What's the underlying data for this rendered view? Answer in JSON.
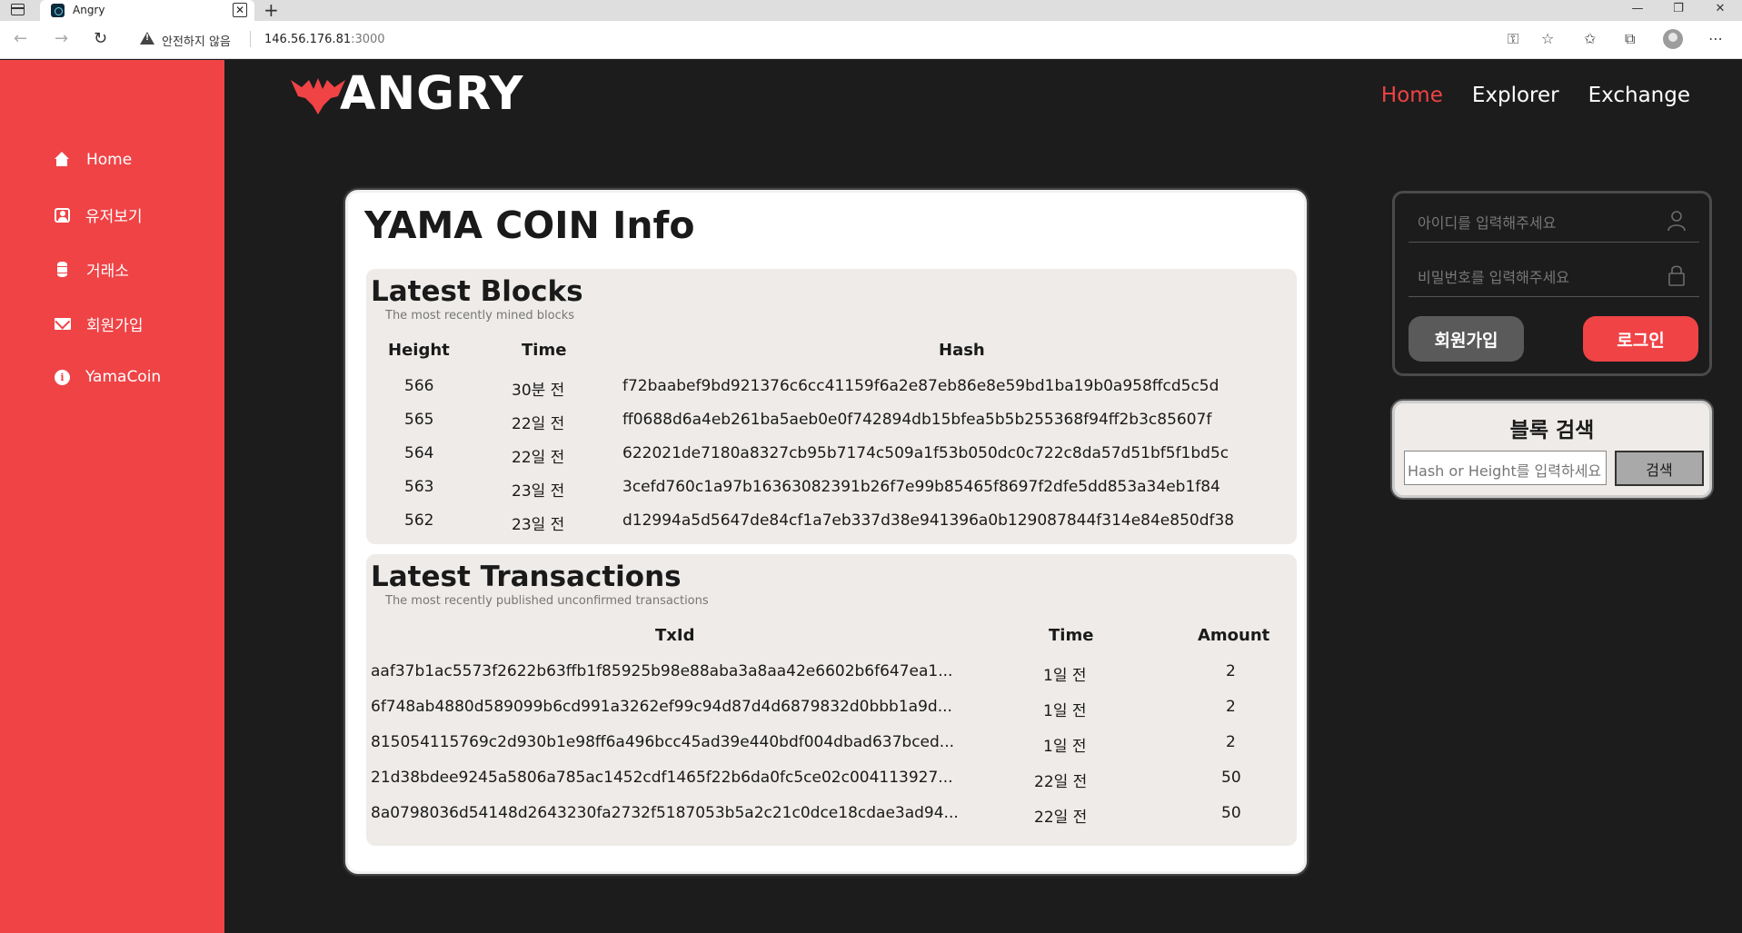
{
  "browser": {
    "tab_title": "Angry",
    "tab_close": "✕",
    "new_tab": "+",
    "security_label": "안전하지 않음",
    "url_host": "146.56.176.81",
    "url_port": ":3000",
    "window_controls": [
      "—",
      "❐",
      "✕"
    ]
  },
  "logo": {
    "text": "ANGRY"
  },
  "nav": [
    {
      "label": "Home",
      "active": true
    },
    {
      "label": "Explorer",
      "active": false
    },
    {
      "label": "Exchange",
      "active": false
    }
  ],
  "sidebar": {
    "items": [
      {
        "label": "Home",
        "icon": "home-icon"
      },
      {
        "label": "유저보기",
        "icon": "user-icon"
      },
      {
        "label": "거래소",
        "icon": "database-icon"
      },
      {
        "label": "회원가입",
        "icon": "mail-icon"
      },
      {
        "label": "YamaCoin",
        "icon": "info-icon"
      }
    ]
  },
  "main": {
    "title": "YAMA COIN Info",
    "blocks": {
      "title": "Latest Blocks",
      "subtitle": "The most recently mined blocks",
      "columns": [
        "Height",
        "Time",
        "Hash"
      ],
      "rows": [
        {
          "height": "566",
          "time": "30분 전",
          "hash": "f72baabef9bd921376c6cc41159f6a2e87eb86e8e59bd1ba19b0a958ffcd5c5d"
        },
        {
          "height": "565",
          "time": "22일 전",
          "hash": "ff0688d6a4eb261ba5aeb0e0f742894db15bfea5b5b255368f94ff2b3c85607f"
        },
        {
          "height": "564",
          "time": "22일 전",
          "hash": "622021de7180a8327cb95b7174c509a1f53b050dc0c722c8da57d51bf5f1bd5c"
        },
        {
          "height": "563",
          "time": "23일 전",
          "hash": "3cefd760c1a97b16363082391b26f7e99b85465f8697f2dfe5dd853a34eb1f84"
        },
        {
          "height": "562",
          "time": "23일 전",
          "hash": "d12994a5d5647de84cf1a7eb337d38e941396a0b129087844f314e84e850df38"
        }
      ]
    },
    "transactions": {
      "title": "Latest Transactions",
      "subtitle": "The most recently published unconfirmed transactions",
      "columns": [
        "TxId",
        "Time",
        "Amount"
      ],
      "rows": [
        {
          "txid": "aaf37b1ac5573f2622b63ffb1f85925b98e88aba3a8aa42e6602b6f647ea1...",
          "time": "1일 전",
          "amount": "2"
        },
        {
          "txid": "6f748ab4880d589099b6cd991a3262ef99c94d87d4d6879832d0bbb1a9d...",
          "time": "1일 전",
          "amount": "2"
        },
        {
          "txid": "815054115769c2d930b1e98ff6a496bcc45ad39e440bdf004dbad637bced...",
          "time": "1일 전",
          "amount": "2"
        },
        {
          "txid": "21d38bdee9245a5806a785ac1452cdf1465f22b6da0fc5ce02c004113927...",
          "time": "22일 전",
          "amount": "50"
        },
        {
          "txid": "8a0798036d54148d2643230fa2732f5187053b5a2c21c0dce18cdae3ad94...",
          "time": "22일 전",
          "amount": "50"
        }
      ]
    }
  },
  "login": {
    "id_placeholder": "아이디를 입력해주세요",
    "pw_placeholder": "비밀번호를 입력해주세요",
    "signup_label": "회원가입",
    "login_label": "로그인"
  },
  "block_search": {
    "title": "블록 검색",
    "placeholder": "Hash or Height를 입력하세요",
    "button_label": "검색"
  },
  "colors": {
    "accent": "#ef4346",
    "background": "#1c1c1c",
    "panel": "#eeebe8"
  }
}
